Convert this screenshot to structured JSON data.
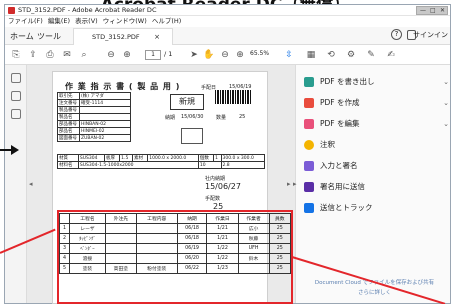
{
  "caption": "Acrobat Reader DC（無償）",
  "window": {
    "title": "STD_3152.PDF - Adobe Acrobat Reader DC",
    "controls": {
      "minimize": "—",
      "maximize": "□",
      "close": "✕"
    }
  },
  "menu": [
    "ファイル(F)",
    "編集(E)",
    "表示(V)",
    "ウィンドウ(W)",
    "ヘルプ(H)"
  ],
  "tabs": {
    "home": "ホーム",
    "tools": "ツール",
    "document": "STD_3152.PDF",
    "close": "×",
    "help": "?",
    "signin": "サインイン"
  },
  "toolbar": {
    "page_current": "1",
    "page_total": "/ 1",
    "zoom": "65.5%",
    "icons": [
      "create-icon",
      "print-icon",
      "email-icon",
      "search-icon",
      "prev-page-icon",
      "next-page-icon",
      "select-icon",
      "hand-icon",
      "zoom-out-icon",
      "zoom-in-icon",
      "fit-icon",
      "scroll-icon",
      "comment-icon",
      "sign-icon"
    ]
  },
  "right_panel": {
    "items": [
      {
        "label": "PDF を書き出し",
        "color": "#2a9d8f"
      },
      {
        "label": "PDF を作成",
        "color": "#e94c3d"
      },
      {
        "label": "PDF を編集",
        "color": "#e9507a"
      },
      {
        "label": "注釈",
        "color": "#f4b400"
      },
      {
        "label": "入力と署名",
        "color": "#7b5cd6"
      },
      {
        "label": "署名用に送信",
        "color": "#5a2ea6"
      },
      {
        "label": "送信とトラック",
        "color": "#1473e6"
      }
    ],
    "footer": "Document Cloud でファイルを保存および共有",
    "footer_link": "さらに詳しく"
  },
  "pdf": {
    "heading": "作 業 指 示 書 ( 製 品 用 )",
    "issue_label": "手配日",
    "issue_date": "15/06/19",
    "customer_label": "取引先",
    "customer": "(株) アマダ",
    "order_label": "注文番号",
    "order": "確受-1114",
    "newbox": "新規",
    "delivery_label": "納期",
    "delivery": "15/06/30",
    "qty_label": "数量",
    "qty": "25",
    "fields": [
      {
        "label": "製品番号",
        "value": ""
      },
      {
        "label": "製品名",
        "value": ""
      },
      {
        "label": "部品番号",
        "value": "HINBAN-02"
      },
      {
        "label": "部品名",
        "value": "HINMEI-02"
      },
      {
        "label": "図面番号",
        "value": "ZUBAN-02"
      }
    ],
    "material_label": "材質",
    "material": "SUS304",
    "thickness_label": "板厚",
    "thickness": "1.5",
    "size_label": "素材",
    "size": "1000.0 x 2000.0",
    "sheet_label": "個数",
    "sheet": "1",
    "dim": "300.0 x 300.0",
    "stock_label": "材料名",
    "stock": "SUS304-1.5-1000x2000",
    "stock_count": "10",
    "weight": "2.8",
    "due_label": "社内納期",
    "due": "15/06/27",
    "count_label": "手配数",
    "count": "25",
    "table_header": [
      "",
      "工程名",
      "外注先",
      "工程内容",
      "納期",
      "作業日",
      "作業者",
      "員数"
    ],
    "rows": [
      [
        "1",
        "レーザ",
        "",
        "",
        "06/18",
        "1/21",
        "広小",
        "25"
      ],
      [
        "2",
        "ﾀｯﾋﾟﾝｸﾞ",
        "",
        "",
        "06/18",
        "1/21",
        "秋藤",
        "25"
      ],
      [
        "3",
        "ﾍﾞﾝﾀﾞｰ",
        "",
        "",
        "06/19",
        "1/22",
        "UFH",
        "25"
      ],
      [
        "4",
        "溶接",
        "",
        "",
        "06/20",
        "1/22",
        "鈴木",
        "25"
      ],
      [
        "5",
        "塗装",
        "高田塗",
        "粉付塗装",
        "06/22",
        "1/23",
        "",
        "25"
      ]
    ]
  }
}
